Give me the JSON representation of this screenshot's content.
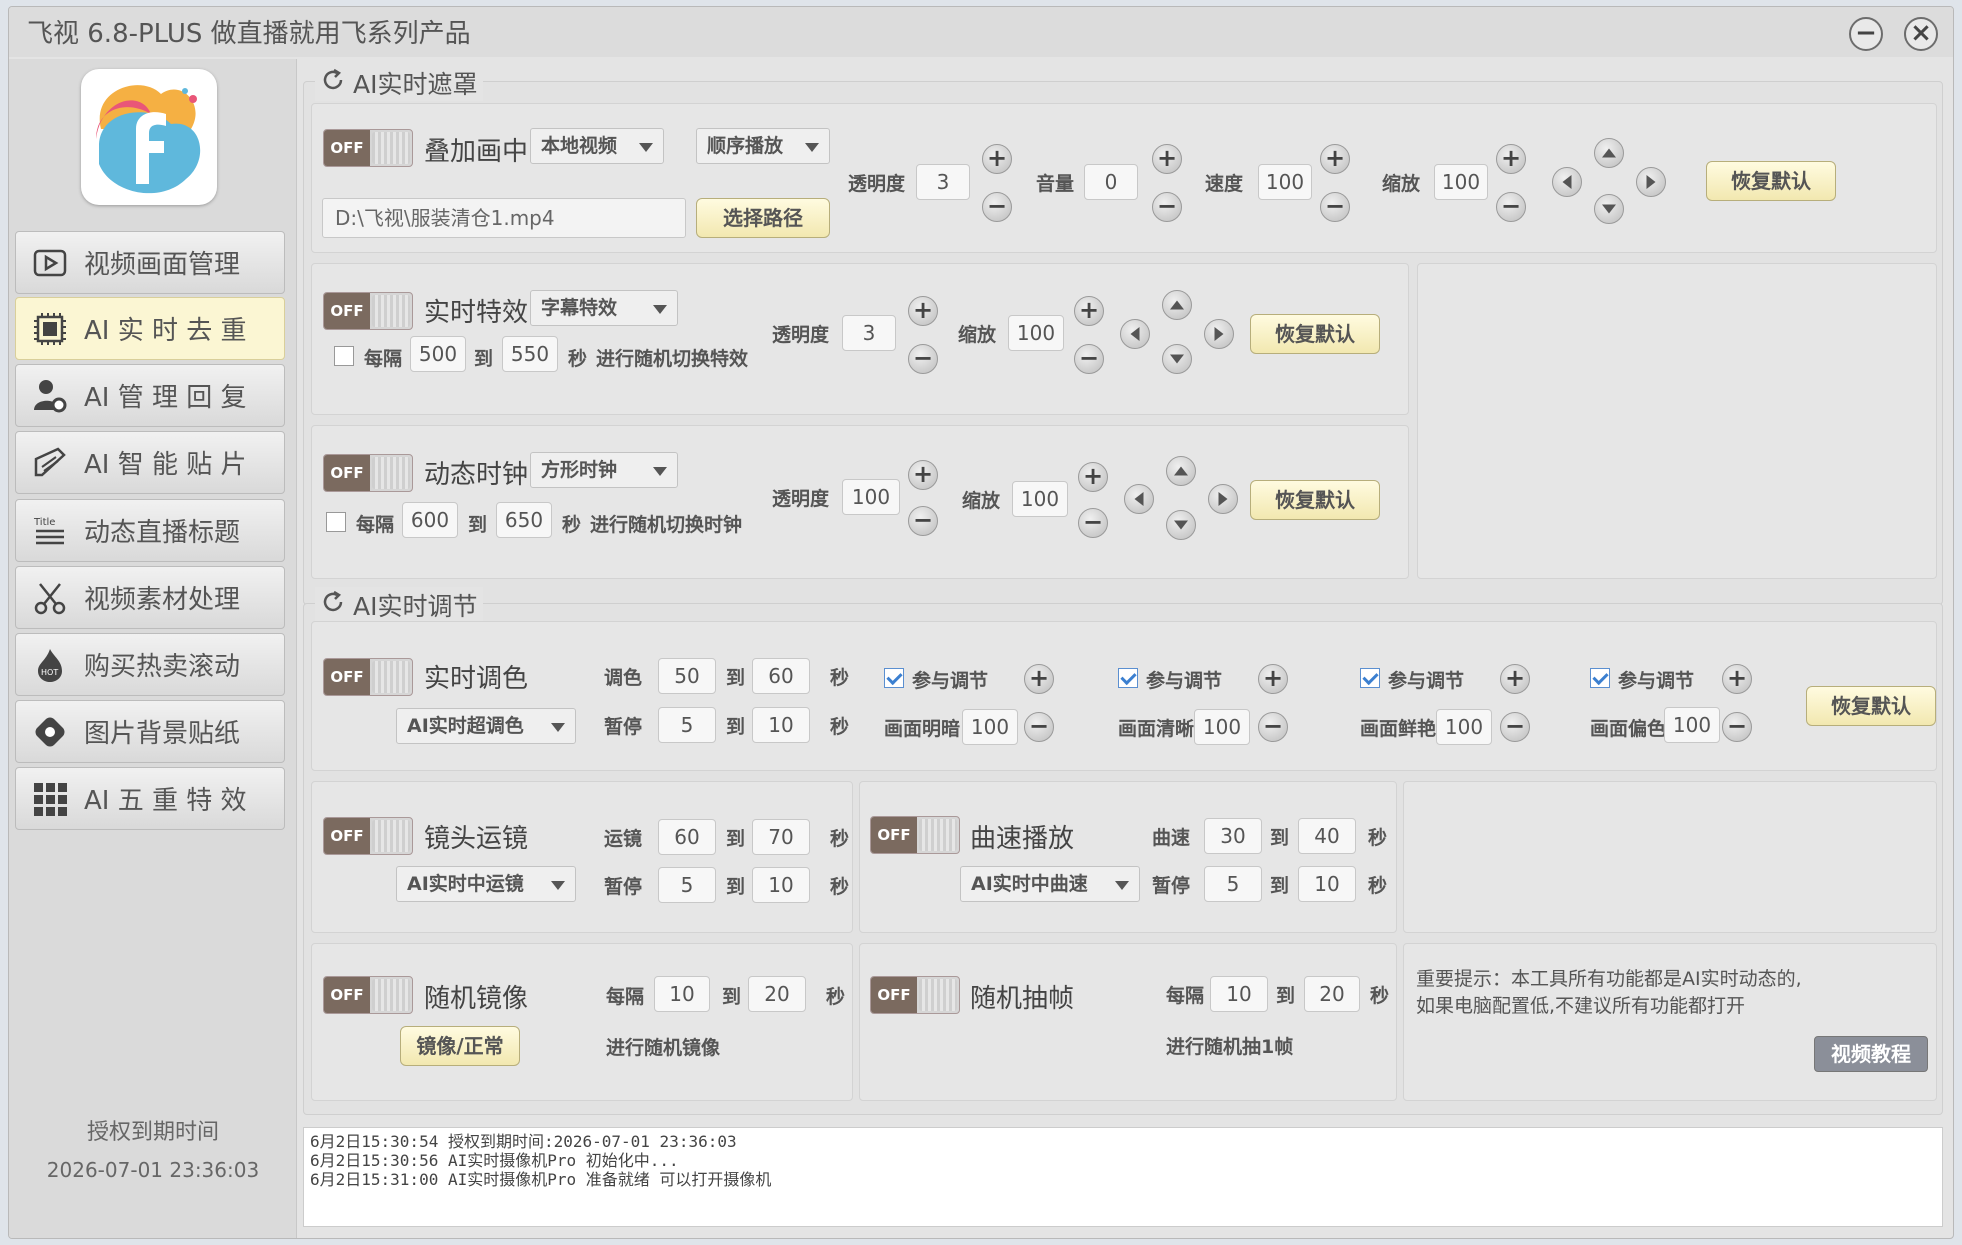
{
  "window": {
    "title": "飞视 6.8-PLUS 做直播就用飞系列产品",
    "minimize": "−",
    "close": "×"
  },
  "sidebar": {
    "items": [
      {
        "label": "视频画面管理",
        "icon": "play-square-icon"
      },
      {
        "label": "AI 实 时 去 重",
        "icon": "chip-icon"
      },
      {
        "label": "AI 管 理 回 复",
        "icon": "user-gear-icon"
      },
      {
        "label": "AI 智 能 贴 片",
        "icon": "pencil-icon"
      },
      {
        "label": "动态直播标题",
        "icon": "title-icon"
      },
      {
        "label": "视频素材处理",
        "icon": "scissors-icon"
      },
      {
        "label": "购买热卖滚动",
        "icon": "hot-icon"
      },
      {
        "label": "图片背景贴纸",
        "icon": "tag-icon"
      },
      {
        "label": "AI 五 重 特 效",
        "icon": "grid-icon"
      }
    ],
    "active_index": 1,
    "license_label": "授权到期时间",
    "license_date": "2026-07-01 23:36:03",
    "title_icon_text": "Title"
  },
  "groups": {
    "mask_title": "AI实时遮罩",
    "adjust_title": "AI实时调节"
  },
  "common": {
    "off": "OFF",
    "reset": "恢复默认",
    "to": "到",
    "sec": "秒",
    "every": "每隔",
    "opacity": "透明度",
    "scale": "缩放",
    "pause": "暂停",
    "participate": "参与调节"
  },
  "overlay": {
    "title": "叠加画中画",
    "source": "本地视频",
    "mode": "顺序播放",
    "path": "D:\\飞视\\服装清仓1.mp4",
    "choose_path": "选择路径",
    "opacity": "3",
    "volume_label": "音量",
    "volume": "0",
    "speed_label": "速度",
    "speed": "100",
    "scale": "100"
  },
  "effects": {
    "title": "实时特效",
    "type": "字幕特效",
    "opacity": "3",
    "scale": "100",
    "from": "500",
    "to": "550",
    "suffix": "进行随机切换特效"
  },
  "clock": {
    "title": "动态时钟",
    "type": "方形时钟",
    "opacity": "100",
    "scale": "100",
    "from": "600",
    "to": "650",
    "suffix": "进行随机切换时钟"
  },
  "color": {
    "title": "实时调色",
    "mode": "AI实时超调色",
    "tone_label": "调色",
    "tone_from": "50",
    "tone_to": "60",
    "pause_from": "5",
    "pause_to": "10",
    "brightness_label": "画面明暗",
    "brightness": "100",
    "clarity_label": "画面清晰",
    "clarity": "100",
    "vivid_label": "画面鲜艳",
    "vivid": "100",
    "tint_label": "画面偏色",
    "tint": "100"
  },
  "lens": {
    "title": "镜头运镜",
    "mode": "AI实时中运镜",
    "move_label": "运镜",
    "move_from": "60",
    "move_to": "70",
    "pause_from": "5",
    "pause_to": "10"
  },
  "curve": {
    "title": "曲速播放",
    "mode": "AI实时中曲速",
    "speed_label": "曲速",
    "speed_from": "30",
    "speed_to": "40",
    "pause_from": "5",
    "pause_to": "10"
  },
  "mirror": {
    "title": "随机镜像",
    "button": "镜像/正常",
    "from": "10",
    "to": "20",
    "suffix": "进行随机镜像"
  },
  "frame": {
    "title": "随机抽帧",
    "from": "10",
    "to": "20",
    "suffix": "进行随机抽1帧"
  },
  "notice": {
    "line1": "重要提示：本工具所有功能都是AI实时动态的,",
    "line2": "如果电脑配置低,不建议所有功能都打开",
    "tutorial": "视频教程"
  },
  "log": [
    "6月2日15:30:54 授权到期时间:2026-07-01 23:36:03",
    "6月2日15:30:56 AI实时摄像机Pro 初始化中...",
    "6月2日15:31:00 AI实时摄像机Pro 准备就绪 可以打开摄像机"
  ]
}
